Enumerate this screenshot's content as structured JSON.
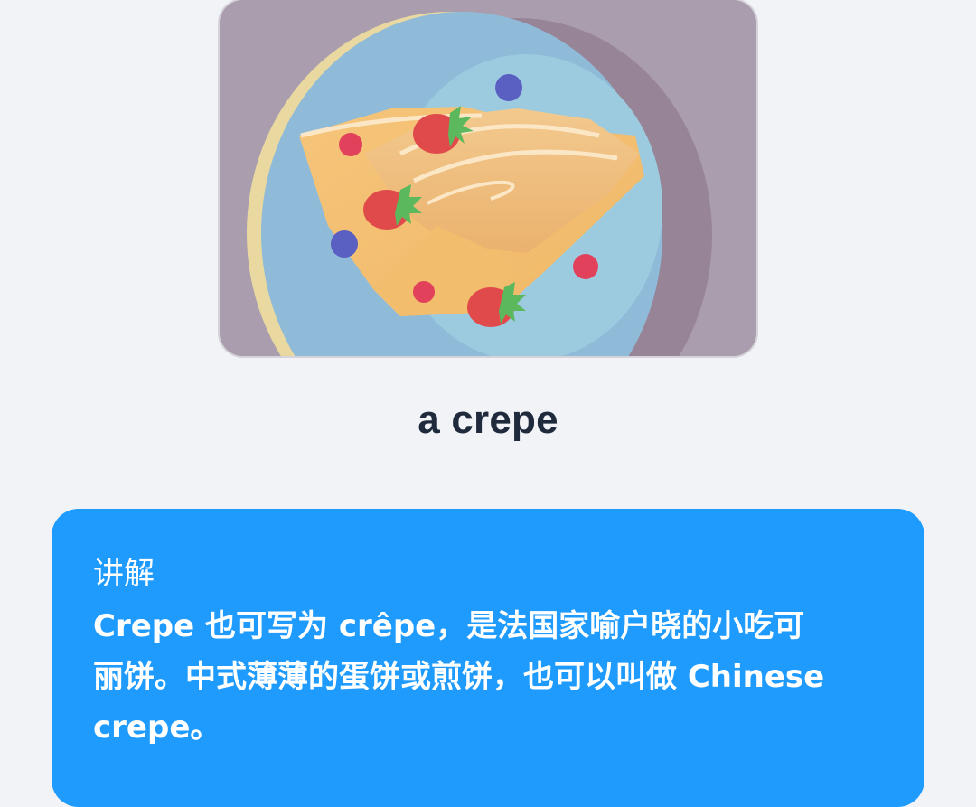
{
  "illustration": {
    "alt": "a crepe",
    "colors": {
      "card_bg": "#aa9eae",
      "plate": "#8fbbd8",
      "plate_rim": "#e9d9a0",
      "crepe": "#f4c577",
      "strawberry": "#e14a4a",
      "blueberry": "#5a5fc2",
      "raspberry": "#e2415c"
    }
  },
  "word": {
    "text": "a crepe"
  },
  "explanation": {
    "title": "讲解",
    "text": "Crepe 也可写为 crêpe，是法国家喻户晓的小吃可丽饼。中式薄薄的蛋饼或煎饼，也可以叫做 Chinese crepe。"
  },
  "theme": {
    "background": "#f1f3f6",
    "word_color": "#1f2a3c",
    "card_accent": "#1e9bfd"
  }
}
